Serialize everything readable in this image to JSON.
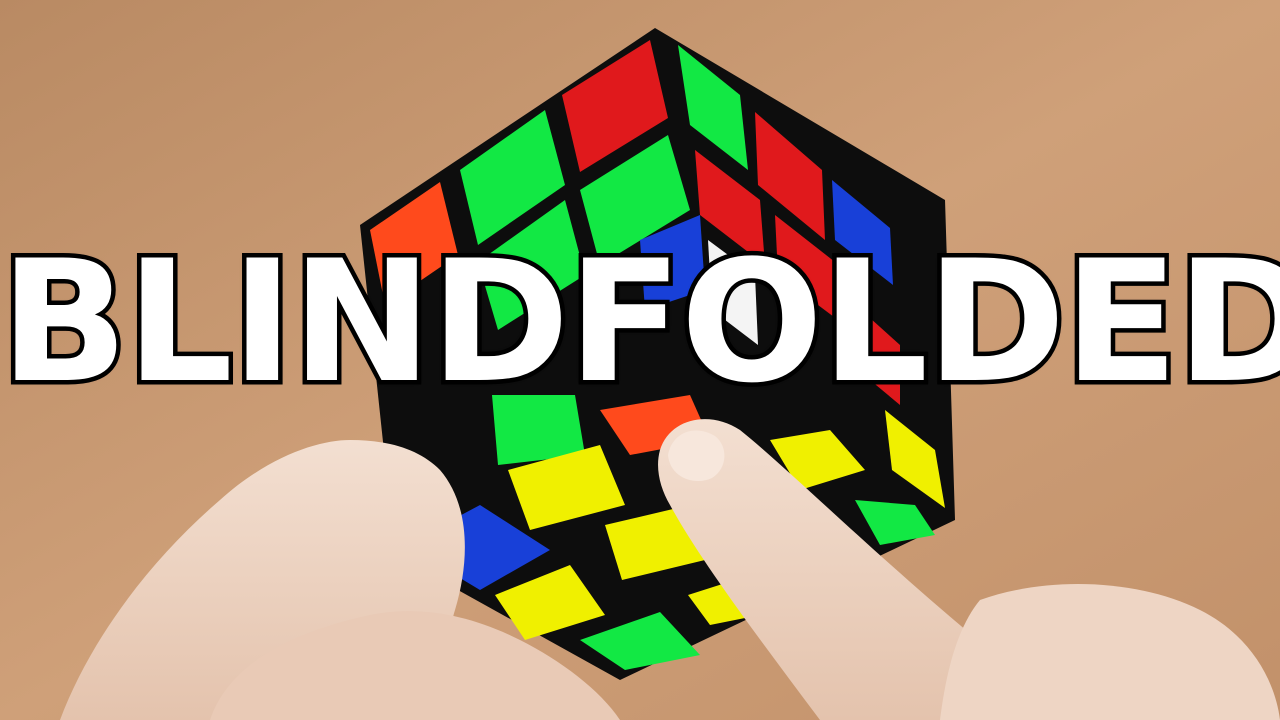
{
  "thumbnail": {
    "title": "BLINDFOLDED"
  },
  "scene": {
    "subject": "rubiks-cube-in-hands",
    "colors": {
      "background_wood": "#c89a72",
      "cube_body": "#0d0d0d",
      "red": "#e0191c",
      "orange": "#ff4a1c",
      "green": "#12e844",
      "blue": "#1840d8",
      "yellow": "#f0f000",
      "white": "#f4f4f4",
      "skin": "#efd7c6",
      "text_fill": "#ffffff",
      "text_outline": "#000000"
    }
  }
}
